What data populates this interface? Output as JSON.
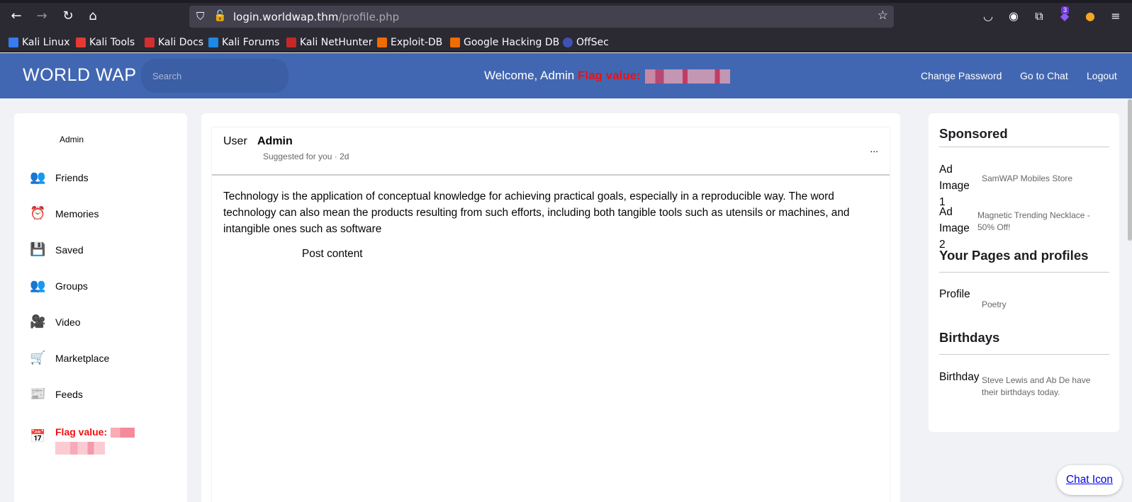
{
  "browser": {
    "url_host": "login.worldwap.thm",
    "url_path": "/profile.php",
    "extension_badge": "3",
    "bookmarks": [
      {
        "label": "Kali Linux",
        "color": "#367bf0"
      },
      {
        "label": "Kali Tools",
        "color": "#e53935"
      },
      {
        "label": "Kali Docs",
        "color": "#d32f2f"
      },
      {
        "label": "Kali Forums",
        "color": "#1e88e5"
      },
      {
        "label": "Kali NetHunter",
        "color": "#c62828"
      },
      {
        "label": "Exploit-DB",
        "color": "#ef6c00"
      },
      {
        "label": "Google Hacking DB",
        "color": "#ef6c00"
      },
      {
        "label": "OffSec",
        "color": "#3f51b5"
      }
    ]
  },
  "header": {
    "brand": "WORLD WAP",
    "search_placeholder": "Search",
    "welcome": "Welcome, Admin",
    "flag_label": "Flag value:",
    "links": {
      "change_password": "Change Password",
      "go_to_chat": "Go to Chat",
      "logout": "Logout"
    },
    "color": "#4267b2"
  },
  "sidebar": {
    "user": "Admin",
    "items": [
      {
        "label": "Friends",
        "icon": "friends-icon"
      },
      {
        "label": "Memories",
        "icon": "memories-icon"
      },
      {
        "label": "Saved",
        "icon": "saved-icon"
      },
      {
        "label": "Groups",
        "icon": "groups-icon"
      },
      {
        "label": "Video",
        "icon": "video-icon"
      },
      {
        "label": "Marketplace",
        "icon": "marketplace-icon"
      },
      {
        "label": "Feeds",
        "icon": "feeds-icon"
      }
    ],
    "flag_label": "Flag value:"
  },
  "post": {
    "user_label": "User",
    "author": "Admin",
    "meta": "Suggested for you · 2d",
    "more": "...",
    "text": "Technology is the application of conceptual knowledge for achieving practical goals, especially in a reproducible way. The word technology can also mean the products resulting from such efforts, including both tangible tools such as utensils or machines, and intangible ones such as software",
    "content_label": "Post content"
  },
  "right": {
    "sponsored_heading": "Sponsored",
    "ads": [
      {
        "image_alt": "Ad Image 1",
        "text": "SamWAP Mobiles Store"
      },
      {
        "image_alt": "Ad Image 2",
        "text": "Magnetic Trending Necklace - 50% Off!"
      }
    ],
    "pages_heading": "Your Pages and profiles",
    "profile_label": "Profile",
    "profile_text": "Poetry",
    "birthdays_heading": "Birthdays",
    "birthday_label": "Birthday",
    "birthday_text": "Steve Lewis and Ab De have their birthdays today."
  },
  "chat": {
    "label": "Chat Icon"
  }
}
